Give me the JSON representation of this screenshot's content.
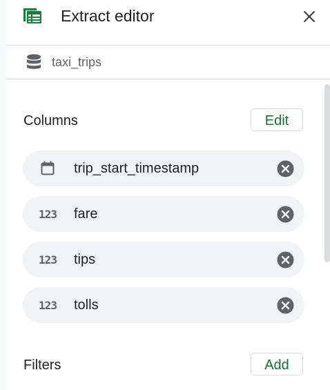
{
  "header": {
    "title": "Extract editor",
    "app_icon": "table-icon",
    "close_icon": "close-icon"
  },
  "source": {
    "name": "taxi_trips",
    "icon": "database-icon"
  },
  "columns": {
    "title": "Columns",
    "edit_label": "Edit",
    "items": [
      {
        "label": "trip_start_timestamp",
        "type_icon": "calendar-icon"
      },
      {
        "label": "fare",
        "type_icon": "123"
      },
      {
        "label": "tips",
        "type_icon": "123"
      },
      {
        "label": "tolls",
        "type_icon": "123"
      }
    ]
  },
  "filters": {
    "title": "Filters",
    "add_label": "Add"
  },
  "colors": {
    "accent": "#188038",
    "button_text": "#137333",
    "chip_bg": "#f1f3f4",
    "icon_gray": "#5f6368"
  }
}
